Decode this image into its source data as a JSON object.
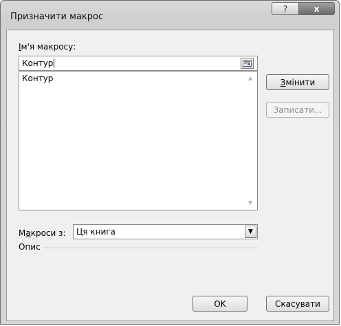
{
  "window": {
    "title": "Призначити макрос",
    "help_glyph": "?",
    "close_glyph": "x"
  },
  "macro_name": {
    "label_access": "І",
    "label_rest": "м'я макросу:",
    "value": "Контур"
  },
  "macro_list": {
    "items": [
      "Контур"
    ]
  },
  "buttons": {
    "edit_access": "З",
    "edit_rest": "мінити",
    "record": "Записати...",
    "ok": "OK",
    "cancel": "Скасувати"
  },
  "macros_in": {
    "label_pre": "М",
    "label_access": "а",
    "label_post": "кроси з:",
    "value": "Ця книга"
  },
  "description": {
    "label": "Опис"
  },
  "colors": {
    "window_frame": "#d6d6d6",
    "client_bg": "#f0f0f0",
    "close_button": "#7a7a7a"
  }
}
